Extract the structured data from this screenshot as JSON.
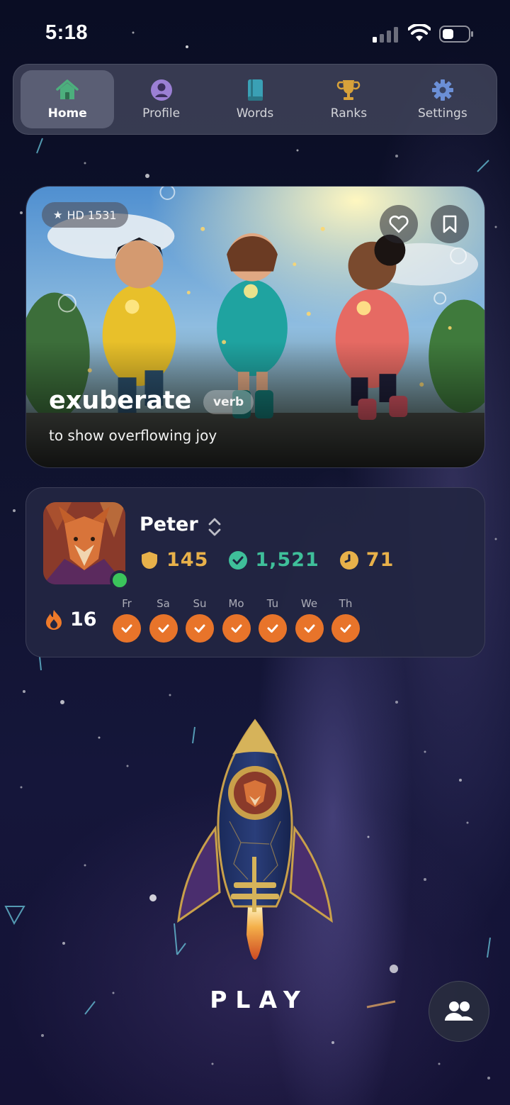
{
  "status_bar": {
    "time": "5:18"
  },
  "nav": {
    "items": [
      {
        "label": "Home",
        "icon": "home-icon",
        "active": true,
        "color": "#4caf7d"
      },
      {
        "label": "Profile",
        "icon": "profile-icon",
        "active": false,
        "color": "#9b7fd4"
      },
      {
        "label": "Words",
        "icon": "book-icon",
        "active": false,
        "color": "#3aa0b5"
      },
      {
        "label": "Ranks",
        "icon": "trophy-icon",
        "active": false,
        "color": "#d8a23a"
      },
      {
        "label": "Settings",
        "icon": "gear-icon",
        "active": false,
        "color": "#6b8fd6"
      }
    ]
  },
  "word_card": {
    "badge": "HD 1531",
    "word": "exuberate",
    "part_of_speech": "verb",
    "definition": "to show overflowing joy"
  },
  "profile": {
    "name": "Peter",
    "stats": {
      "shield": "145",
      "verified": "1,521",
      "clock": "71"
    },
    "streak": "16",
    "week_days": [
      "Fr",
      "Sa",
      "Su",
      "Mo",
      "Tu",
      "We",
      "Th"
    ],
    "online": true
  },
  "play": {
    "label": "PLAY"
  },
  "colors": {
    "accent_orange": "#e8742a",
    "gold": "#e8b14a",
    "teal": "#3fbf9a",
    "online": "#3bc45b"
  }
}
